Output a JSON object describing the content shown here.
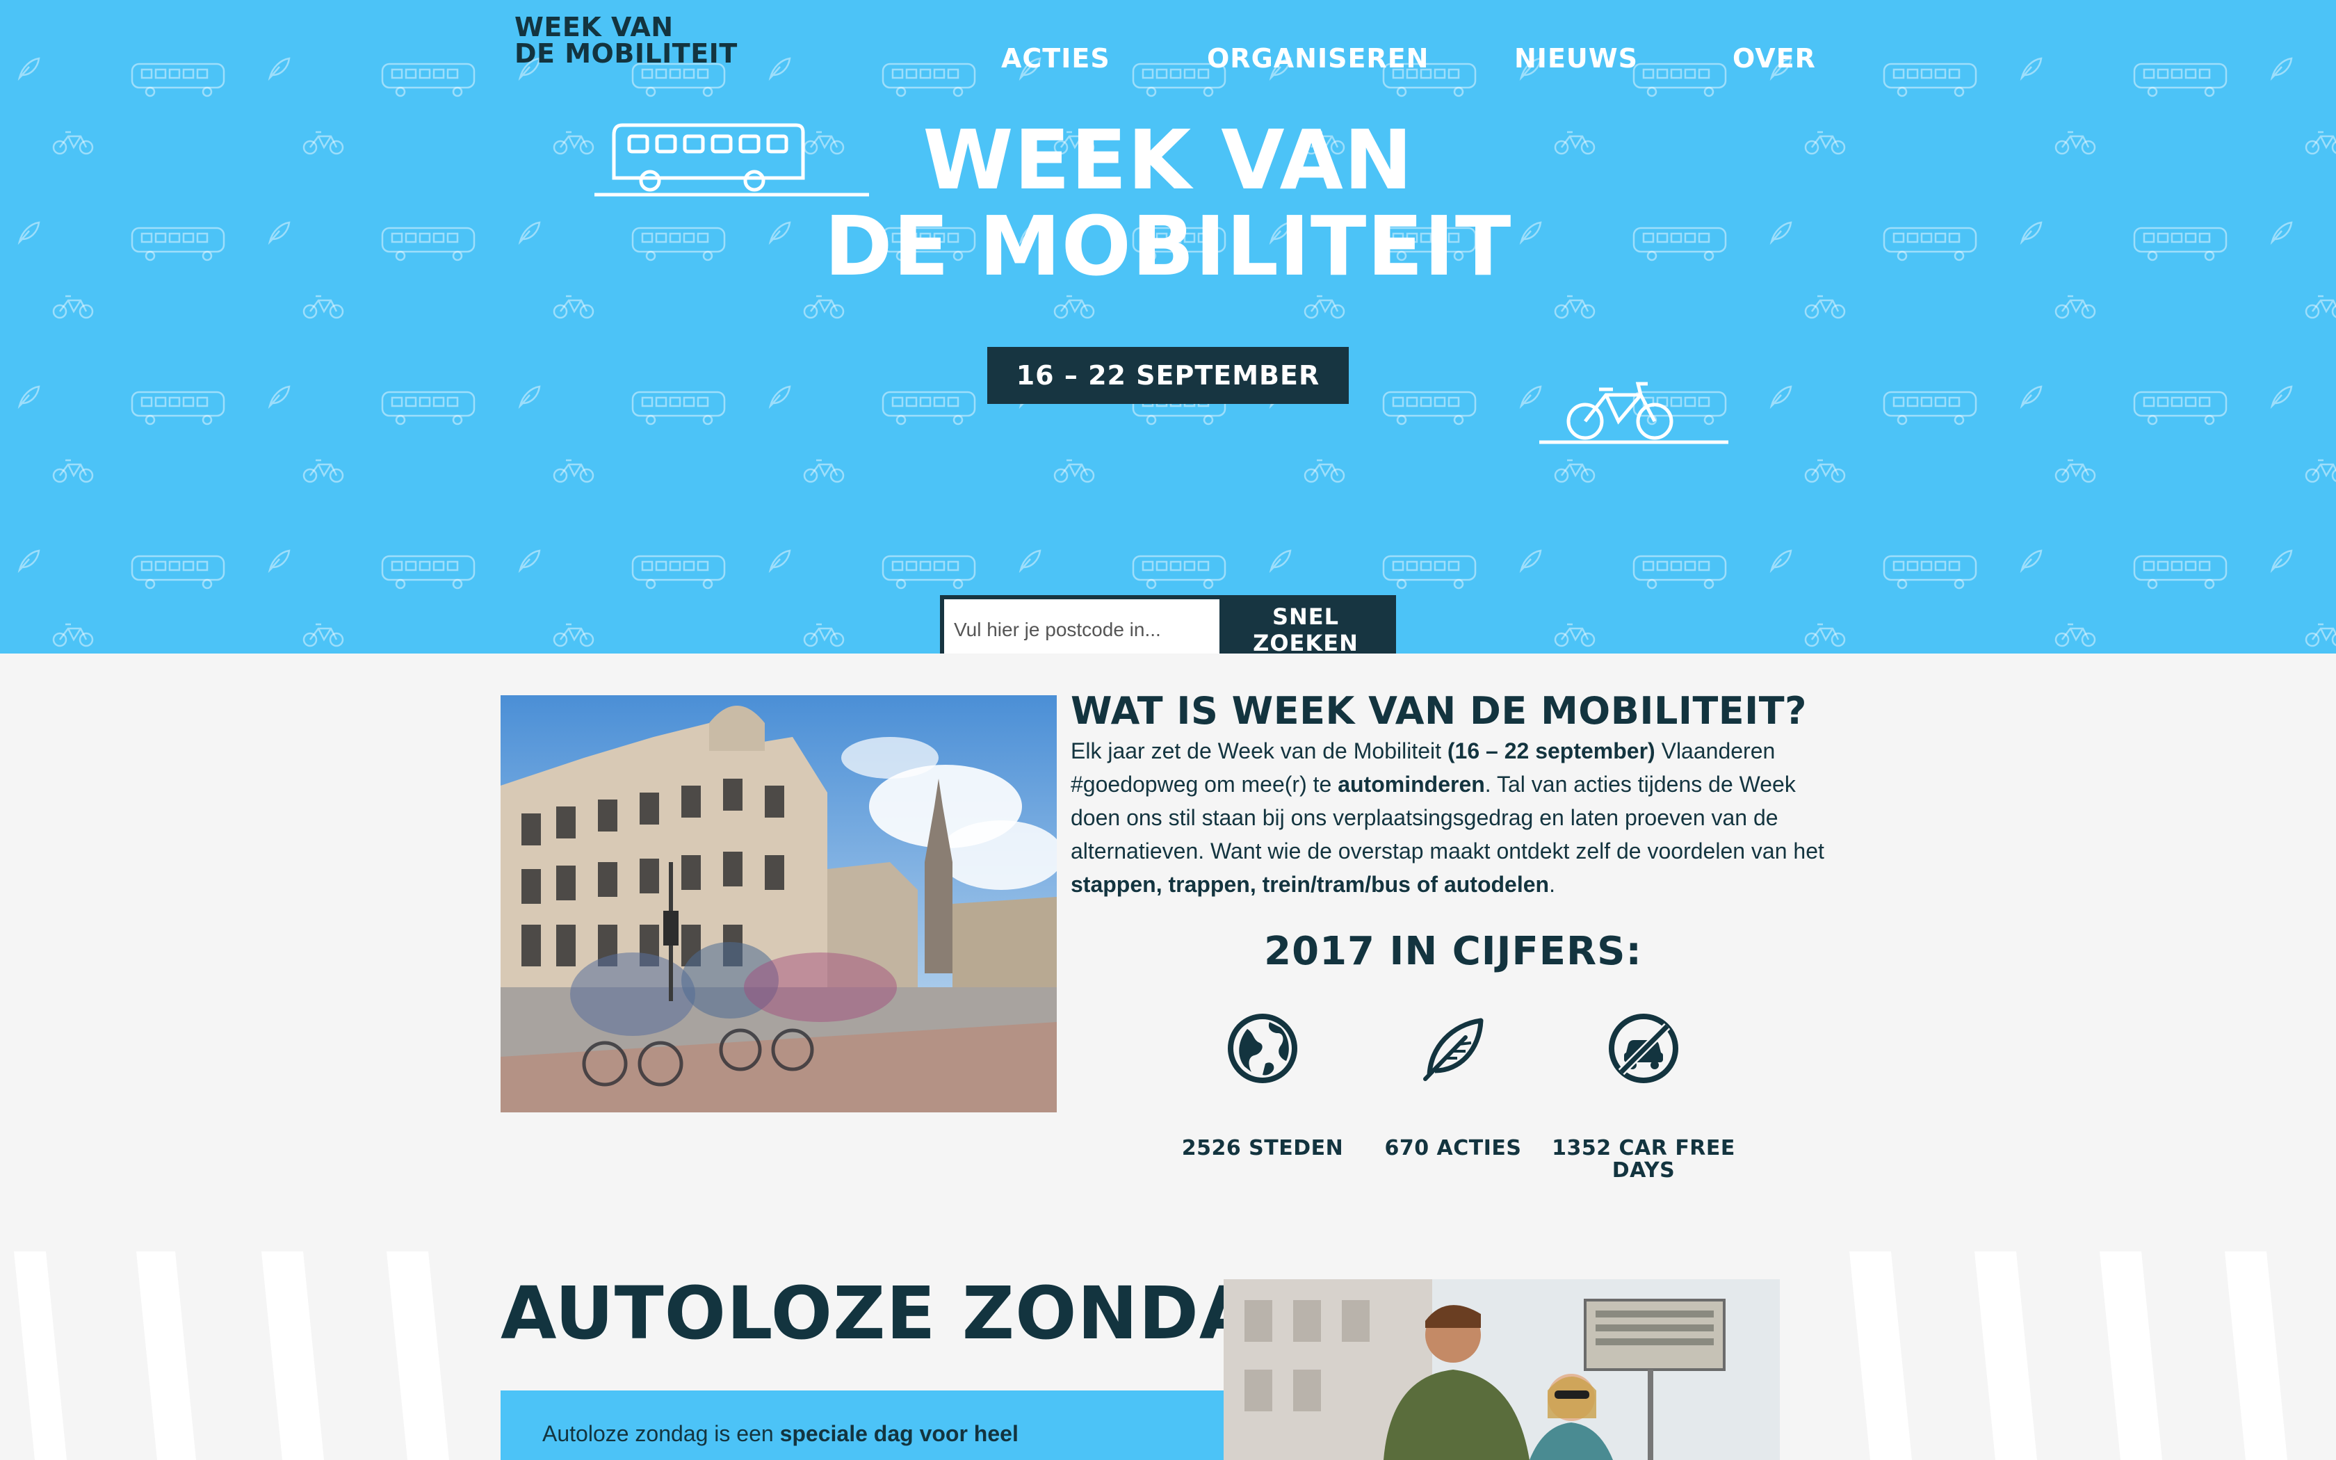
{
  "logo": {
    "line1": "WEEK VAN",
    "line2": "DE MOBILITEIT"
  },
  "nav": [
    {
      "label": "ACTIES"
    },
    {
      "label": "ORGANISEREN"
    },
    {
      "label": "NIEUWS"
    },
    {
      "label": "OVER"
    }
  ],
  "hero": {
    "title_line1": "WEEK VAN",
    "title_line2": "DE MOBILITEIT",
    "date": "16 – 22 SEPTEMBER"
  },
  "search": {
    "placeholder": "Vul hier je postcode in...",
    "button": "SNEL ZOEKEN"
  },
  "about": {
    "heading": "WAT IS WEEK VAN DE MOBILITEIT?",
    "p1": "Elk jaar zet de Week van de Mobiliteit ",
    "p1_bold": "(16 – 22 september)",
    "p2": " Vlaanderen #goedopweg om mee(r) te ",
    "p2_bold": "autominderen",
    "p3": ". Tal van acties tijdens de Week doen ons stil staan bij ons verplaatsingsgedrag en laten proeven van de alternatieven. Want wie de overstap maakt ontdekt zelf de voordelen van het ",
    "p3_bold": "stappen, trappen, trein/tram/bus of autodelen",
    "p4": "."
  },
  "stats": {
    "title": "2017 IN CIJFERS:",
    "items": [
      {
        "label": "2526 STEDEN",
        "icon": "globe-icon"
      },
      {
        "label": "670 ACTIES",
        "icon": "leaf-icon"
      },
      {
        "label": "1352 CAR FREE DAYS",
        "icon": "no-car-icon"
      }
    ]
  },
  "autoloze": {
    "heading": "AUTOLOZE ZONDAG",
    "text": "Autoloze zondag is een ",
    "text_bold": "speciale dag voor heel"
  },
  "colors": {
    "hero_blue": "#4cc3f7",
    "navy": "#13343f",
    "badge_navy": "#173541",
    "background": "#f5f5f5"
  }
}
